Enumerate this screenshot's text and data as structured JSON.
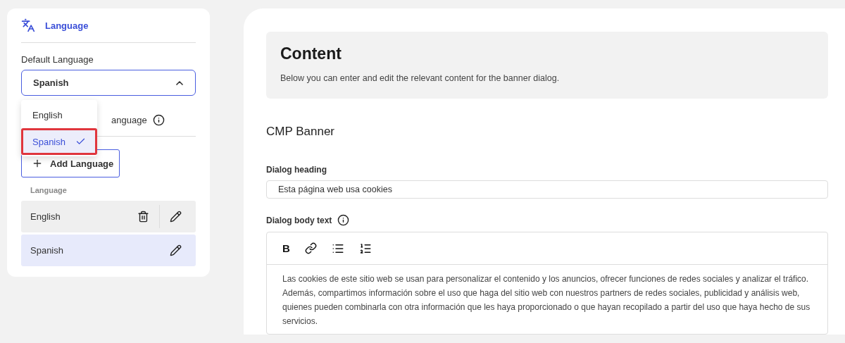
{
  "sidebar": {
    "section_title": "Language",
    "default_language": {
      "label": "Default Language",
      "value": "Spanish",
      "expanded": true,
      "options": [
        {
          "label": "English",
          "selected": false,
          "highlighted": false
        },
        {
          "label": "Spanish",
          "selected": true,
          "highlighted": true
        }
      ]
    },
    "hidden_label": "anguage",
    "add_button": "Add Language",
    "list_header": "Language",
    "languages": [
      {
        "name": "English",
        "selected": false,
        "deletable": true
      },
      {
        "name": "Spanish",
        "selected": true,
        "deletable": false
      }
    ]
  },
  "content": {
    "title": "Content",
    "description": "Below you can enter and edit the relevant content for the banner dialog.",
    "section": "CMP Banner",
    "heading_label": "Dialog heading",
    "heading_value": "Esta página web usa cookies",
    "body_label": "Dialog body text",
    "toolbar_bold": "B",
    "body_value": "Las cookies de este sitio web se usan para personalizar el contenido y los anuncios, ofrecer funciones de redes sociales y analizar el tráfico. Además, compartimos información sobre el uso que haga del sitio web con nuestros partners de redes sociales, publicidad y análisis web, quienes pueden combinarla con otra información que les haya proporcionado o que hayan recopilado a partir del uso que haya hecho de sus servicios."
  }
}
